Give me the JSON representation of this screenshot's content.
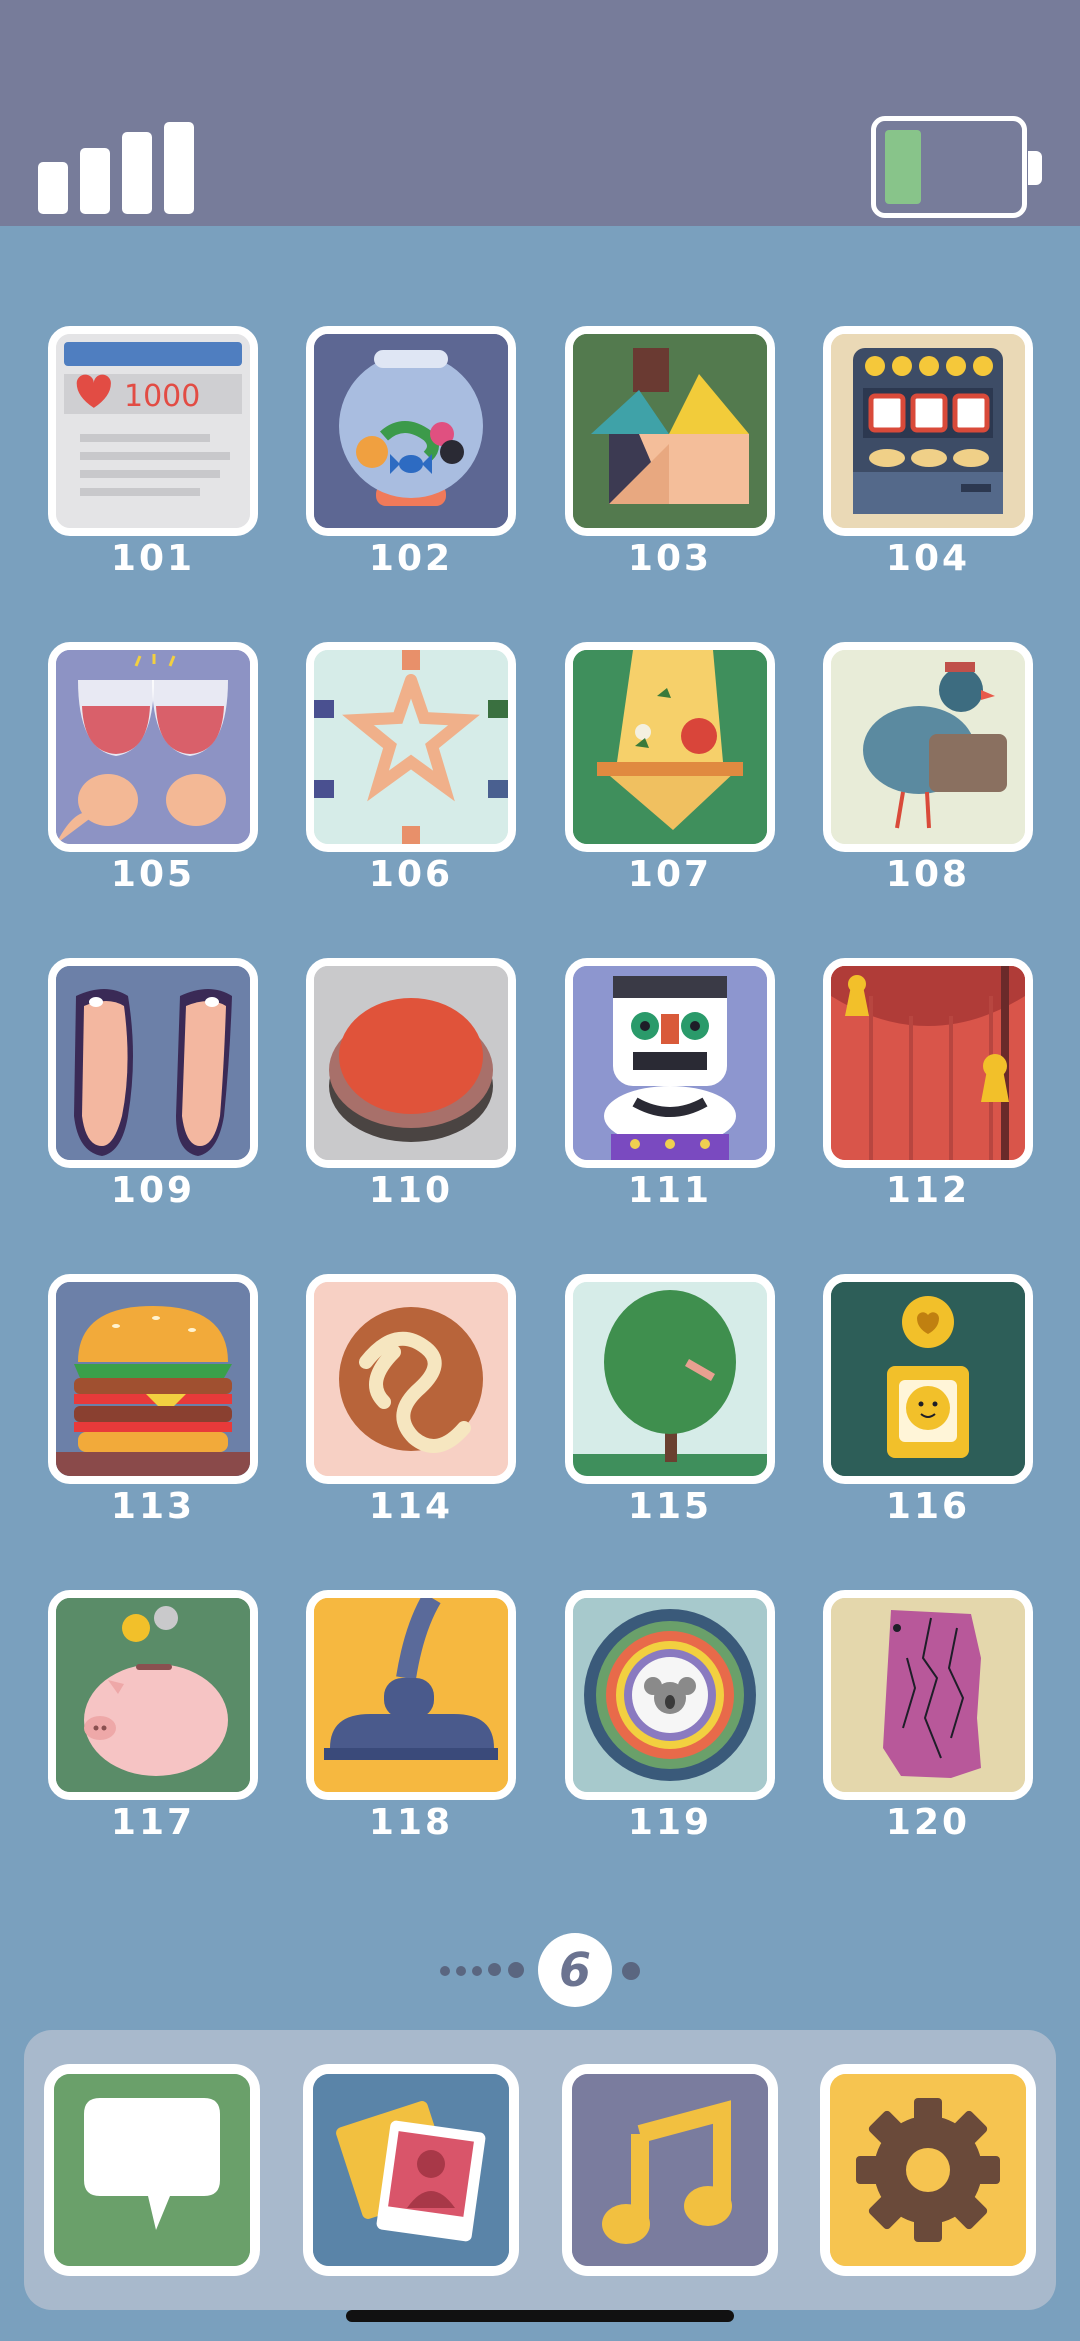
{
  "status_bar": {
    "signal_icon": "signal-bars-icon",
    "battery_icon": "battery-low-icon",
    "battery_color": "#88c48a"
  },
  "levels": [
    {
      "number": "101",
      "icon": "social-post-likes-icon"
    },
    {
      "number": "102",
      "icon": "candy-jar-icon"
    },
    {
      "number": "103",
      "icon": "tangram-house-icon"
    },
    {
      "number": "104",
      "icon": "slot-machine-icon"
    },
    {
      "number": "105",
      "icon": "wine-toast-icon"
    },
    {
      "number": "106",
      "icon": "hands-star-icon"
    },
    {
      "number": "107",
      "icon": "pizza-slice-icon"
    },
    {
      "number": "108",
      "icon": "pigeon-mailbag-icon"
    },
    {
      "number": "109",
      "icon": "flip-flops-icon"
    },
    {
      "number": "110",
      "icon": "red-button-icon"
    },
    {
      "number": "111",
      "icon": "lion-dance-icon"
    },
    {
      "number": "112",
      "icon": "stage-curtain-icon"
    },
    {
      "number": "113",
      "icon": "burger-icon"
    },
    {
      "number": "114",
      "icon": "cinnamon-bun-icon"
    },
    {
      "number": "115",
      "icon": "tree-icon"
    },
    {
      "number": "116",
      "icon": "heart-coin-box-icon"
    },
    {
      "number": "117",
      "icon": "piggy-bank-icon"
    },
    {
      "number": "118",
      "icon": "vacuum-cleaner-icon"
    },
    {
      "number": "119",
      "icon": "koala-target-icon"
    },
    {
      "number": "120",
      "icon": "torn-paper-icon"
    }
  ],
  "pagination": {
    "current_page": "6"
  },
  "dock": [
    {
      "icon": "messages-icon"
    },
    {
      "icon": "photos-icon"
    },
    {
      "icon": "music-icon"
    },
    {
      "icon": "settings-gear-icon"
    }
  ]
}
